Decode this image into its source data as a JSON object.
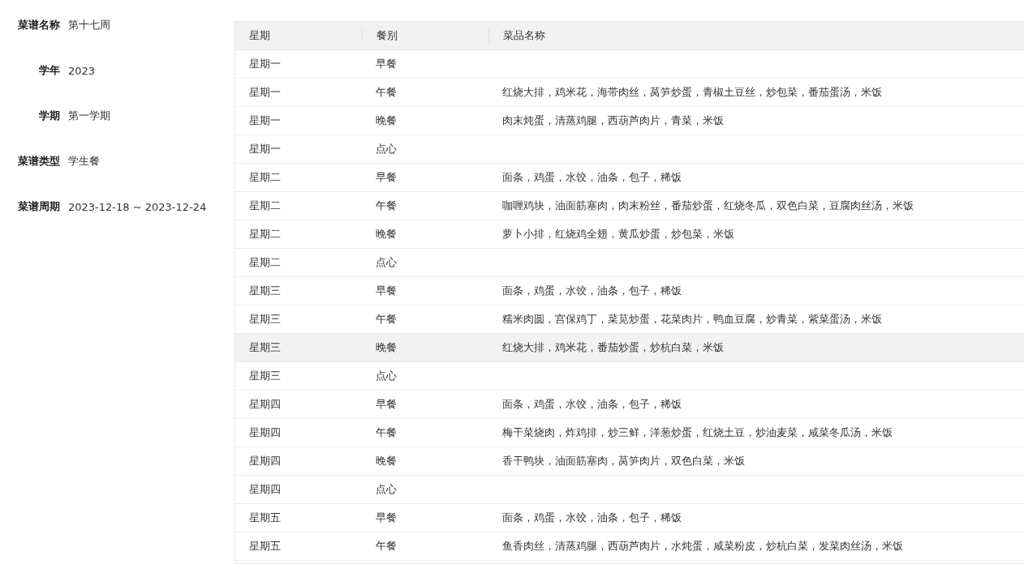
{
  "fields": [
    {
      "label": "菜谱名称",
      "value": "第十七周"
    },
    {
      "label": "学年",
      "value": "2023"
    },
    {
      "label": "学期",
      "value": "第一学期"
    },
    {
      "label": "菜谱类型",
      "value": "学生餐"
    },
    {
      "label": "菜谱周期",
      "value": "2023-12-18 ~ 2023-12-24"
    }
  ],
  "table": {
    "columns": [
      "星期",
      "餐别",
      "菜品名称"
    ],
    "rows": [
      {
        "day": "星期一",
        "meal": "早餐",
        "dishes": "",
        "highlighted": false
      },
      {
        "day": "星期一",
        "meal": "午餐",
        "dishes": "红烧大排，鸡米花，海带肉丝，莴笋炒蛋，青椒土豆丝，炒包菜，番茄蛋汤，米饭",
        "highlighted": false
      },
      {
        "day": "星期一",
        "meal": "晚餐",
        "dishes": "肉末炖蛋，清蒸鸡腿，西葫芦肉片，青菜，米饭",
        "highlighted": false
      },
      {
        "day": "星期一",
        "meal": "点心",
        "dishes": "",
        "highlighted": false
      },
      {
        "day": "星期二",
        "meal": "早餐",
        "dishes": "面条，鸡蛋，水饺，油条，包子，稀饭",
        "highlighted": false
      },
      {
        "day": "星期二",
        "meal": "午餐",
        "dishes": "咖喱鸡块，油面筋塞肉，肉末粉丝，番茄炒蛋，红烧冬瓜，双色白菜，豆腐肉丝汤，米饭",
        "highlighted": false
      },
      {
        "day": "星期二",
        "meal": "晚餐",
        "dishes": "萝卜小排，红烧鸡全翅，黄瓜炒蛋，炒包菜，米饭",
        "highlighted": false
      },
      {
        "day": "星期二",
        "meal": "点心",
        "dishes": "",
        "highlighted": false
      },
      {
        "day": "星期三",
        "meal": "早餐",
        "dishes": "面条，鸡蛋，水饺，油条，包子，稀饭",
        "highlighted": false
      },
      {
        "day": "星期三",
        "meal": "午餐",
        "dishes": "糯米肉圆，宫保鸡丁，菜苋炒蛋，花菜肉片，鸭血豆腐，炒青菜，紫菜蛋汤，米饭",
        "highlighted": false
      },
      {
        "day": "星期三",
        "meal": "晚餐",
        "dishes": "红烧大排，鸡米花，番茄炒蛋，炒杭白菜，米饭",
        "highlighted": true
      },
      {
        "day": "星期三",
        "meal": "点心",
        "dishes": "",
        "highlighted": false
      },
      {
        "day": "星期四",
        "meal": "早餐",
        "dishes": "面条，鸡蛋，水饺，油条，包子，稀饭",
        "highlighted": false
      },
      {
        "day": "星期四",
        "meal": "午餐",
        "dishes": "梅干菜烧肉，炸鸡排，炒三鲜，洋葱炒蛋，红烧土豆，炒油麦菜，咸菜冬瓜汤，米饭",
        "highlighted": false
      },
      {
        "day": "星期四",
        "meal": "晚餐",
        "dishes": "香干鸭块，油面筋塞肉，莴笋肉片，双色白菜，米饭",
        "highlighted": false
      },
      {
        "day": "星期四",
        "meal": "点心",
        "dishes": "",
        "highlighted": false
      },
      {
        "day": "星期五",
        "meal": "早餐",
        "dishes": "面条，鸡蛋，水饺，油条，包子，稀饭",
        "highlighted": false
      },
      {
        "day": "星期五",
        "meal": "午餐",
        "dishes": "鱼香肉丝，清蒸鸡腿，西葫芦肉片，水炖蛋，咸菜粉皮，炒杭白菜，发菜肉丝汤，米饭",
        "highlighted": false
      }
    ]
  }
}
